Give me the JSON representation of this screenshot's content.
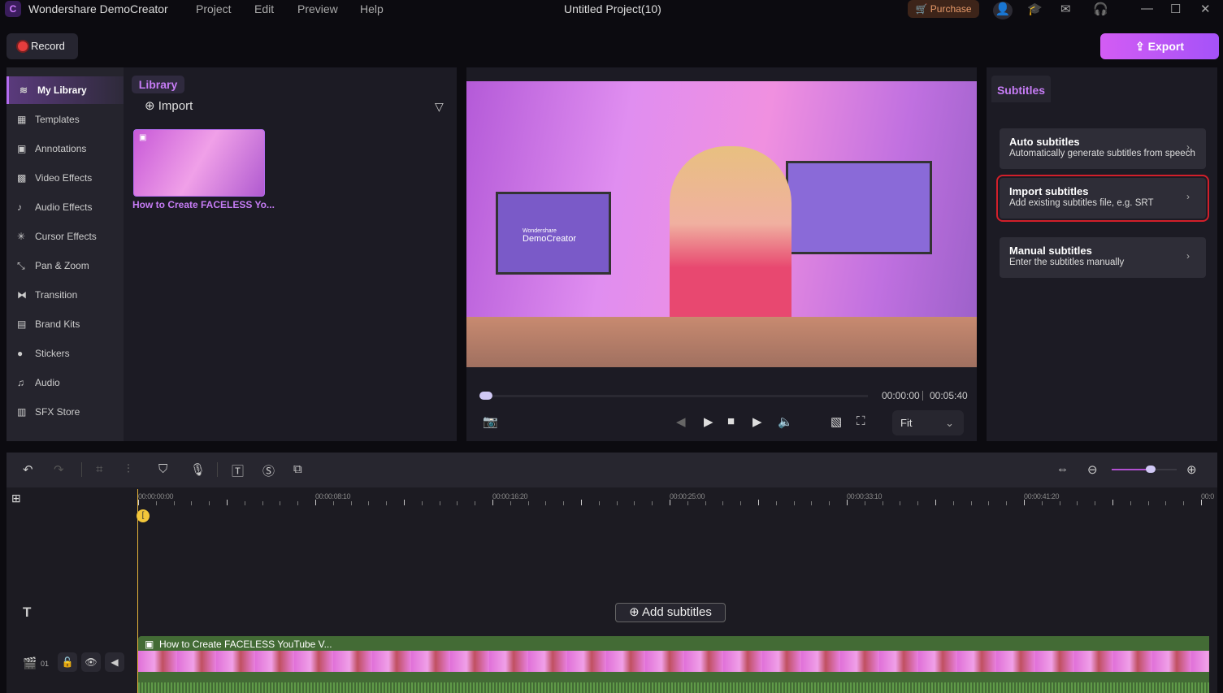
{
  "app": {
    "title": "Wondershare DemoCreator",
    "project_title": "Untitled Project(10)",
    "menu": [
      "Project",
      "Edit",
      "Preview",
      "Help"
    ],
    "purchase": "Purchase"
  },
  "toolbar": {
    "record": "Record",
    "export": "Export"
  },
  "sidebar": {
    "items": [
      {
        "label": "My Library",
        "icon": "layers-icon",
        "active": true
      },
      {
        "label": "Templates",
        "icon": "templates-icon"
      },
      {
        "label": "Annotations",
        "icon": "annotation-icon"
      },
      {
        "label": "Video Effects",
        "icon": "video-effects-icon"
      },
      {
        "label": "Audio Effects",
        "icon": "audio-effects-icon"
      },
      {
        "label": "Cursor Effects",
        "icon": "cursor-icon"
      },
      {
        "label": "Pan & Zoom",
        "icon": "pan-zoom-icon"
      },
      {
        "label": "Transition",
        "icon": "transition-icon"
      },
      {
        "label": "Brand Kits",
        "icon": "brand-kit-icon"
      },
      {
        "label": "Stickers",
        "icon": "sticker-icon"
      },
      {
        "label": "Audio",
        "icon": "music-icon"
      },
      {
        "label": "SFX Store",
        "icon": "store-icon"
      }
    ]
  },
  "library": {
    "tab": "Library",
    "import": "Import",
    "media": [
      {
        "name": "How to Create FACELESS Yo..."
      }
    ]
  },
  "preview": {
    "current_time": "00:00:00",
    "duration": "00:05:40",
    "zoom": "Fit",
    "progress": 0,
    "video_text": [
      "Wondershare",
      "DemoCreator"
    ]
  },
  "subtitles": {
    "tab": "Subtitles",
    "cards": [
      {
        "title": "Auto subtitles",
        "desc": "Automatically generate subtitles from speech"
      },
      {
        "title": "Import subtitles",
        "desc": "Add existing subtitles file, e.g. SRT",
        "selected": true
      },
      {
        "title": "Manual subtitles",
        "desc": "Enter the subtitles manually"
      }
    ]
  },
  "timeline": {
    "ruler": [
      "00:00:00:00",
      "00:00:08:10",
      "00:00:16:20",
      "00:00:25:00",
      "00:00:33:10",
      "00:00:41:20",
      "00:0"
    ],
    "add_subtitles": "Add subtitles",
    "track_number": "01",
    "clip_title": "How to Create FACELESS YouTube V...",
    "zoom_level": 0.6
  },
  "colors": {
    "accent": "#c67cf5",
    "export": "#c057f6",
    "clip": "#436b35",
    "playhead": "#f3c73a",
    "selected_outline": "#d21f2a"
  }
}
